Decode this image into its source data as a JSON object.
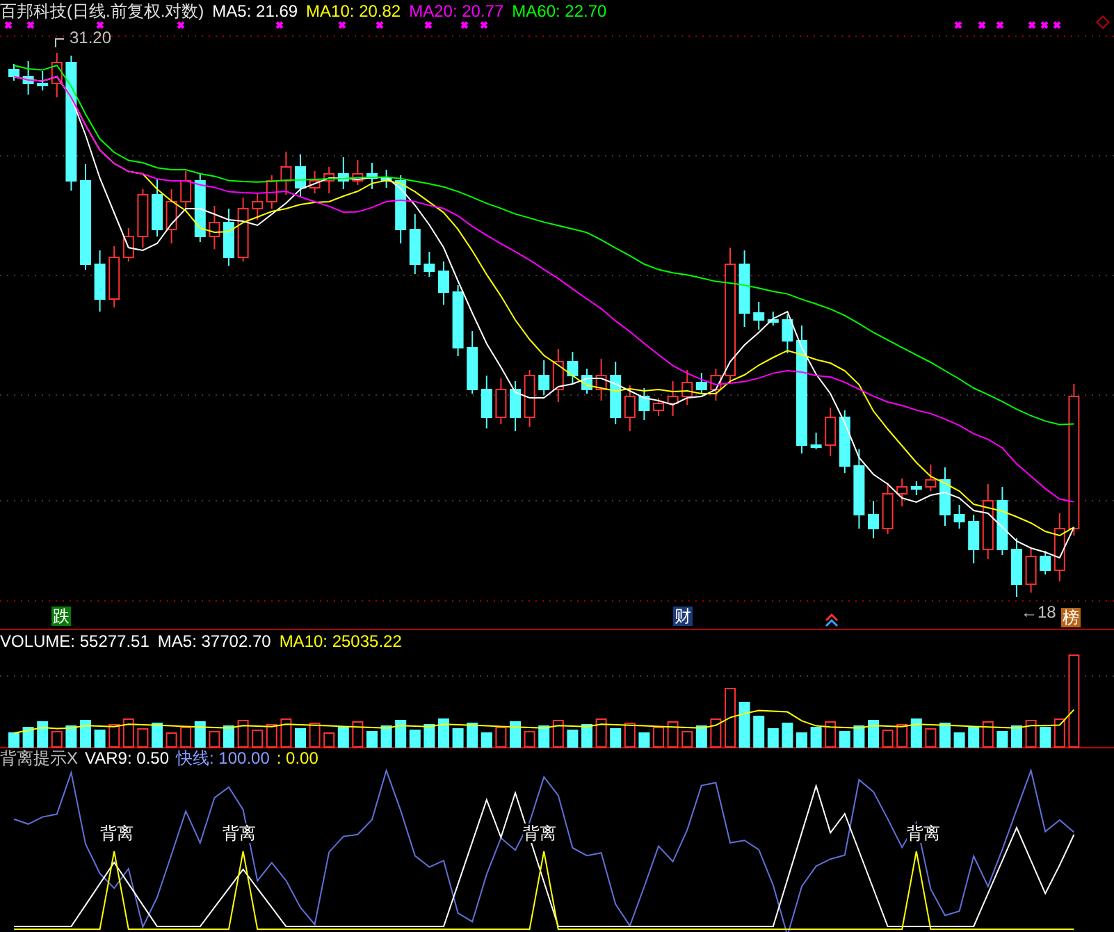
{
  "title": "百邦科技(日线.前复权.对数)",
  "ma_legend": [
    {
      "label": "MA5: 21.69",
      "color": "#ffffff"
    },
    {
      "label": "MA10: 20.82",
      "color": "#ffff00"
    },
    {
      "label": "MA20: 20.77",
      "color": "#ff00ff"
    },
    {
      "label": "MA60: 22.70",
      "color": "#00ff00"
    }
  ],
  "high_label": "31.20",
  "low_label": "←18",
  "badges": [
    {
      "text": "跌",
      "kind": "fall"
    },
    {
      "text": "财",
      "kind": "finance"
    },
    {
      "text": "榜",
      "kind": "list"
    }
  ],
  "volume_legend": [
    {
      "label": "VOLUME: 55277.51",
      "color": "#ffffff"
    },
    {
      "label": "MA5: 37702.70",
      "color": "#ffffff"
    },
    {
      "label": "MA10: 25035.22",
      "color": "#ffff00"
    }
  ],
  "indicator_legend": [
    {
      "label": "背离提示X",
      "color": "#c0c0c0"
    },
    {
      "label": "VAR9: 0.50",
      "color": "#ffffff"
    },
    {
      "label": "快线: 100.00",
      "color": "#8a9cff"
    },
    {
      "label": ": 0.00",
      "color": "#ffff00"
    }
  ],
  "divergence_labels": [
    "背离",
    "背离",
    "背离",
    "背离"
  ]
}
